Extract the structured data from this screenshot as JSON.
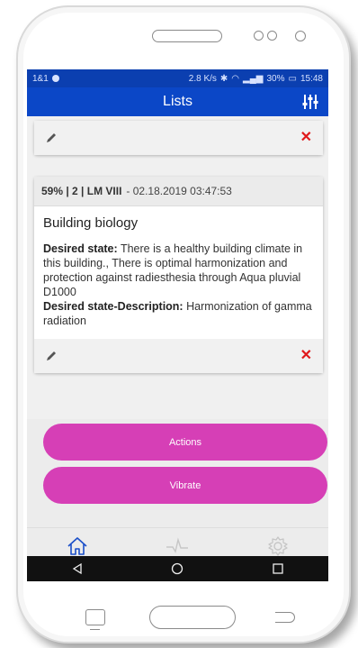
{
  "status_bar": {
    "carrier": "1&1",
    "speed": "2.8 K/s",
    "battery": "30%",
    "time": "15:48"
  },
  "app_bar": {
    "title": "Lists"
  },
  "cards": [
    {
      "header_bold": "59% | 2 | LM VIII",
      "header_date": "- 02.18.2019 03:47:53",
      "title": "Building biology",
      "desired_state_label": "Desired state:",
      "desired_state_text": "There is a healthy building climate in this building., There is optimal harmonization and protection against radiesthesia through Aqua pluvial D1000",
      "description_label": "Desired state-Description:",
      "description_text": "Harmonization of gamma radiation"
    }
  ],
  "buttons": {
    "actions": "Actions",
    "vibrate": "Vibrate"
  },
  "bottom_nav": [
    {
      "icon": "home-icon",
      "active": true
    },
    {
      "icon": "pulse-icon",
      "active": false
    },
    {
      "icon": "gear-icon",
      "active": false
    }
  ],
  "colors": {
    "app_bar": "#0b47c7",
    "status_bar": "#0b3fb0",
    "button": "#d63fb6",
    "delete": "#e0191b",
    "active_nav": "#1b4fc9"
  }
}
